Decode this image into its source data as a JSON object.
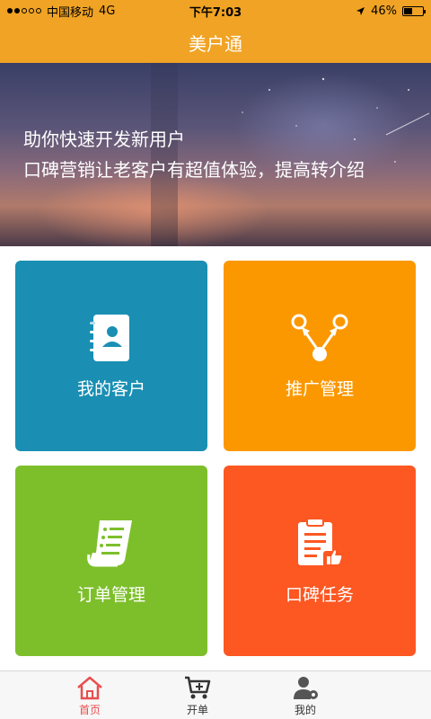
{
  "status_bar": {
    "carrier": "中国移动",
    "network": "4G",
    "time": "下午7:03",
    "battery": "46%",
    "battery_level": 0.46,
    "signal_strength": 2
  },
  "navbar": {
    "title": "美户通"
  },
  "banner": {
    "line1": "助你快速开发新用户",
    "line2": "口碑营销让老客户有超值体验，提高转介绍"
  },
  "tiles": [
    {
      "label": "我的客户",
      "color": "#1a8fb3",
      "icon": "contacts-book-icon"
    },
    {
      "label": "推广管理",
      "color": "#fb9800",
      "icon": "share-network-icon"
    },
    {
      "label": "订单管理",
      "color": "#7dbf2b",
      "icon": "order-list-icon"
    },
    {
      "label": "口碑任务",
      "color": "#fd5722",
      "icon": "clipboard-thumbs-up-icon"
    }
  ],
  "tabbar": {
    "items": [
      {
        "label": "首页",
        "icon": "home-icon",
        "active": true
      },
      {
        "label": "开单",
        "icon": "cart-plus-icon",
        "active": false
      },
      {
        "label": "我的",
        "icon": "user-gear-icon",
        "active": false
      }
    ],
    "active_color": "#e94e4e"
  },
  "colors": {
    "header": "#f0a324"
  }
}
